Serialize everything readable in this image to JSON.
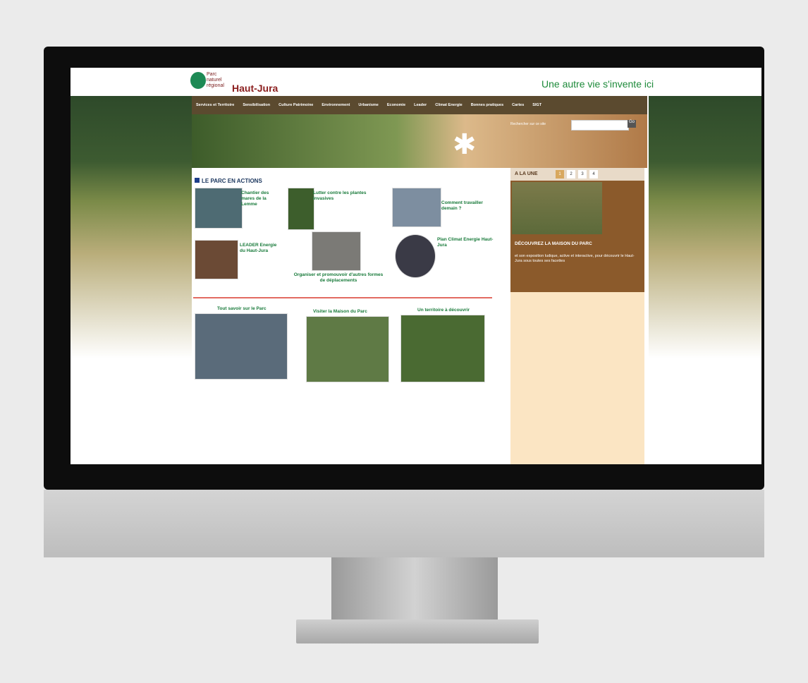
{
  "header": {
    "logo_line1": "Parc",
    "logo_line2": "naturel",
    "logo_line3": "régional",
    "logo_name": "Haut-Jura",
    "tagline": "Une autre vie s'invente ici"
  },
  "nav": {
    "items": [
      "Services et Territoire",
      "Sensibilisation",
      "Culture Patrimoine",
      "Environnement",
      "Urbanisme",
      "Economie",
      "Leader",
      "Climat Energie",
      "Bonnes pratiques",
      "Cartes",
      "SIGT"
    ]
  },
  "banner": {
    "search_label": "Rechercher sur ce site",
    "search_placeholder": "",
    "search_button": "Go"
  },
  "actions": {
    "title": "LE PARC EN ACTIONS",
    "items": [
      "Chantier des mares de la Lemme",
      "Lutter contre les plantes invasives",
      "Comment travailler demain ?",
      "LEADER Energie du Haut-Jura",
      "Organiser et promouvoir d'autres formes de déplacements",
      "Plan Climat Energie Haut-Jura"
    ]
  },
  "bottom": {
    "items": [
      "Tout savoir sur le Parc",
      "Visiter la Maison du Parc",
      "Un territoire à découvrir"
    ]
  },
  "sidebar": {
    "a_la_une": "A LA UNE",
    "pages": [
      "1",
      "2",
      "3",
      "4"
    ],
    "feature_title": "DÉCOUVREZ LA MAISON DU PARC",
    "feature_text": "et son exposition ludique, active et interactive, pour découvrir le Haut-Jura sous toutes ses facettes"
  }
}
